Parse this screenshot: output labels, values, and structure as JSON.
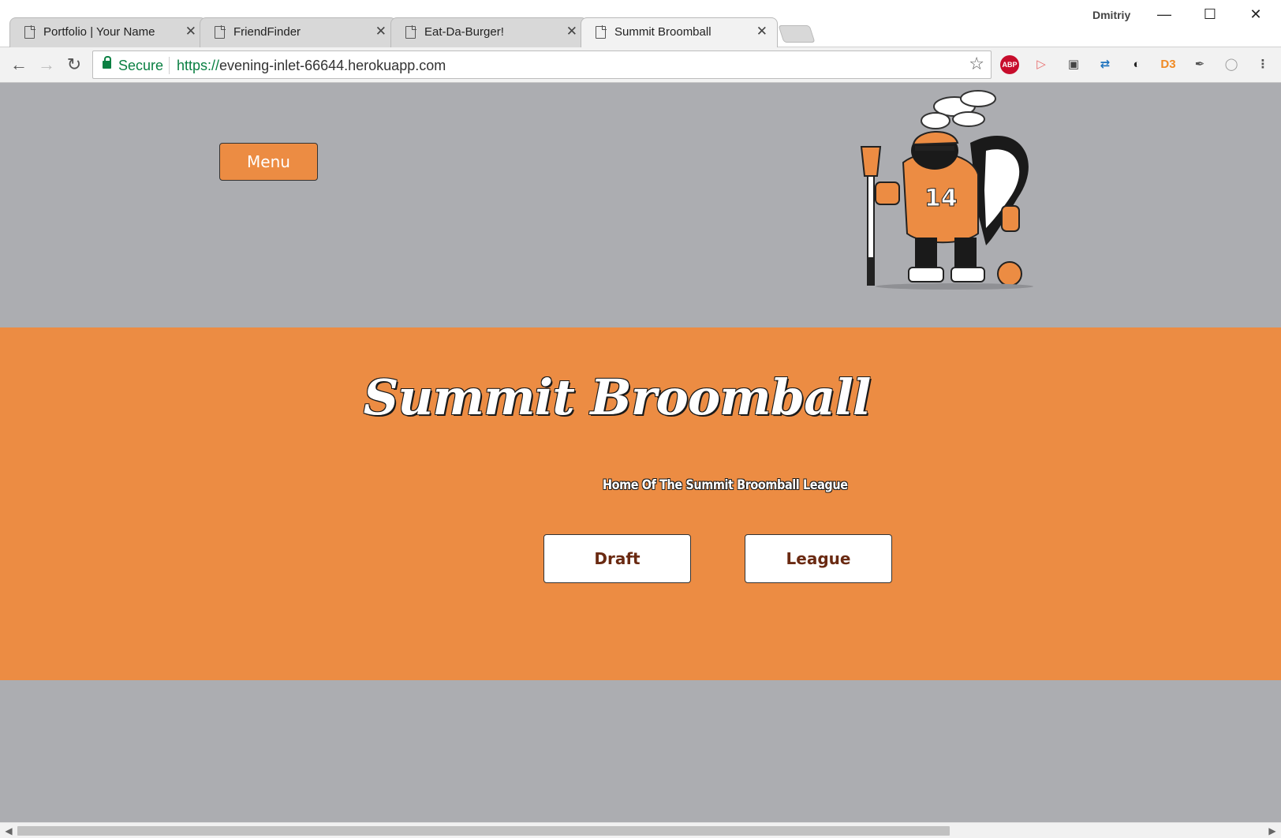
{
  "browser": {
    "tabs": [
      {
        "title": "Portfolio | Your Name",
        "active": false
      },
      {
        "title": "FriendFinder",
        "active": false
      },
      {
        "title": "Eat-Da-Burger!",
        "active": false
      },
      {
        "title": "Summit Broomball",
        "active": true
      }
    ],
    "profile_name": "Dmitriy",
    "secure_label": "Secure",
    "url_scheme": "https://",
    "url_host": "evening-inlet-66644.herokuapp.com",
    "extensions": [
      "abp-icon",
      "cast-icon",
      "screenshot-icon",
      "sync-arrows-icon",
      "grammarly-icon",
      "d3-icon",
      "eyedropper-icon",
      "code-icon"
    ],
    "abp_label": "ABP",
    "d3_label": "D3"
  },
  "page": {
    "menu_label": "Menu",
    "title": "Summit Broomball",
    "subtitle": "Home Of The Summit Broomball League",
    "buttons": {
      "draft": "Draft",
      "league": "League"
    },
    "mascot_number": "14"
  },
  "colors": {
    "page_background": "#acadb1",
    "accent_orange": "#ec8c43",
    "button_text": "#6a2a12",
    "secure_green": "#0b8043"
  }
}
